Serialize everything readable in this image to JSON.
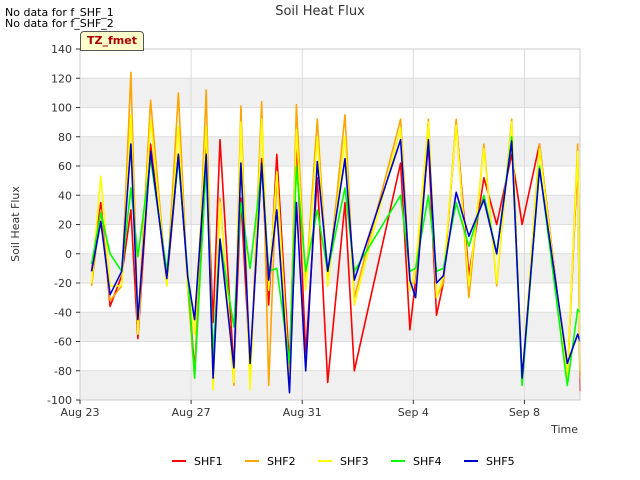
{
  "notices": [
    "No data for f_SHF_1",
    "No data for f_SHF_2"
  ],
  "badge": "TZ_fmet",
  "chart_data": {
    "type": "line",
    "title": "Soil Heat Flux",
    "xlabel": "Time",
    "ylabel": "Soil Heat Flux",
    "xlim": [
      "2023-08-23",
      "2023-09-10"
    ],
    "ylim": [
      -100,
      140
    ],
    "yticks": [
      -100,
      -80,
      -60,
      -40,
      -20,
      0,
      20,
      40,
      60,
      80,
      100,
      120,
      140
    ],
    "xticks": [
      {
        "value": "2023-08-23",
        "label": "Aug 23"
      },
      {
        "value": "2023-08-27",
        "label": "Aug 27"
      },
      {
        "value": "2023-08-31",
        "label": "Aug 31"
      },
      {
        "value": "2023-09-04",
        "label": "Sep 4"
      },
      {
        "value": "2023-09-08",
        "label": "Sep 8"
      }
    ],
    "grid": true,
    "legend_position": "bottom",
    "series": [
      {
        "name": "SHF1",
        "color": "#ff0000",
        "x": [
          "2023-08-23T10:00",
          "2023-08-23T18:00",
          "2023-08-24T02:00",
          "2023-08-24T12:00",
          "2023-08-24T20:00",
          "2023-08-25T02:00",
          "2023-08-25T13:00",
          "2023-08-26T03:00",
          "2023-08-26T13:00",
          "2023-08-26T21:00",
          "2023-08-27T03:00",
          "2023-08-27T13:00",
          "2023-08-27T19:00",
          "2023-08-28T01:00",
          "2023-08-28T13:00",
          "2023-08-28T19:00",
          "2023-08-29T03:00",
          "2023-08-29T13:00",
          "2023-08-29T19:00",
          "2023-08-30T02:00",
          "2023-08-30T13:00",
          "2023-08-30T19:00",
          "2023-08-31T03:00",
          "2023-08-31T13:00",
          "2023-08-31T22:00",
          "2023-09-01T13:00",
          "2023-09-01T21:00",
          "2023-09-03T13:00",
          "2023-09-03T21:00",
          "2023-09-04T02:00",
          "2023-09-04T13:00",
          "2023-09-04T20:00",
          "2023-09-05T02:00",
          "2023-09-05T13:00",
          "2023-09-06T00:00",
          "2023-09-06T13:00",
          "2023-09-07T00:00",
          "2023-09-07T13:00",
          "2023-09-07T22:00",
          "2023-09-08T13:00",
          "2023-09-09T13:00",
          "2023-09-09T22:00",
          "2023-09-10T00:00"
        ],
        "y": [
          -12,
          35,
          -36,
          -15,
          30,
          -58,
          75,
          -20,
          68,
          -15,
          -80,
          73,
          -47,
          78,
          -80,
          38,
          -78,
          65,
          -35,
          68,
          -78,
          78,
          -68,
          52,
          -88,
          35,
          -80,
          62,
          -52,
          -18,
          75,
          -42,
          -20,
          90,
          -15,
          52,
          20,
          68,
          20,
          75,
          -85,
          65,
          -94
        ]
      },
      {
        "name": "SHF2",
        "color": "#ffa500",
        "x": [
          "2023-08-23T10:00",
          "2023-08-23T18:00",
          "2023-08-24T02:00",
          "2023-08-24T12:00",
          "2023-08-24T20:00",
          "2023-08-25T02:00",
          "2023-08-25T13:00",
          "2023-08-26T03:00",
          "2023-08-26T13:00",
          "2023-08-26T21:00",
          "2023-08-27T03:00",
          "2023-08-27T13:00",
          "2023-08-27T19:00",
          "2023-08-28T01:00",
          "2023-08-28T13:00",
          "2023-08-28T19:00",
          "2023-08-29T03:00",
          "2023-08-29T13:00",
          "2023-08-29T19:00",
          "2023-08-30T02:00",
          "2023-08-30T13:00",
          "2023-08-30T19:00",
          "2023-08-31T03:00",
          "2023-08-31T13:00",
          "2023-08-31T22:00",
          "2023-09-01T13:00",
          "2023-09-01T21:00",
          "2023-09-03T13:00",
          "2023-09-03T21:00",
          "2023-09-04T02:00",
          "2023-09-04T13:00",
          "2023-09-04T20:00",
          "2023-09-05T02:00",
          "2023-09-05T13:00",
          "2023-09-06T00:00",
          "2023-09-06T13:00",
          "2023-09-07T00:00",
          "2023-09-07T13:00",
          "2023-09-07T22:00",
          "2023-09-08T13:00",
          "2023-09-09T13:00",
          "2023-09-09T22:00",
          "2023-09-10T00:00"
        ],
        "y": [
          -22,
          30,
          -32,
          -22,
          124,
          -50,
          105,
          -22,
          110,
          -22,
          -85,
          112,
          -90,
          38,
          -90,
          101,
          -88,
          104,
          -90,
          55,
          -88,
          102,
          -22,
          92,
          -22,
          95,
          -30,
          92,
          -20,
          -20,
          92,
          -30,
          -20,
          92,
          -30,
          75,
          -22,
          92,
          -88,
          75,
          -88,
          75,
          -85
        ]
      },
      {
        "name": "SHF3",
        "color": "#ffff00",
        "x": [
          "2023-08-23T10:00",
          "2023-08-23T18:00",
          "2023-08-24T02:00",
          "2023-08-24T12:00",
          "2023-08-24T20:00",
          "2023-08-25T02:00",
          "2023-08-25T13:00",
          "2023-08-26T03:00",
          "2023-08-26T13:00",
          "2023-08-26T21:00",
          "2023-08-27T03:00",
          "2023-08-27T13:00",
          "2023-08-27T19:00",
          "2023-08-28T01:00",
          "2023-08-28T13:00",
          "2023-08-28T19:00",
          "2023-08-29T03:00",
          "2023-08-29T13:00",
          "2023-08-29T19:00",
          "2023-08-30T02:00",
          "2023-08-30T13:00",
          "2023-08-30T19:00",
          "2023-08-31T03:00",
          "2023-08-31T13:00",
          "2023-08-31T22:00",
          "2023-09-01T13:00",
          "2023-09-01T21:00",
          "2023-09-03T13:00",
          "2023-09-03T21:00",
          "2023-09-04T02:00",
          "2023-09-04T13:00",
          "2023-09-04T20:00",
          "2023-09-05T02:00",
          "2023-09-05T13:00",
          "2023-09-06T00:00",
          "2023-09-06T13:00",
          "2023-09-07T00:00",
          "2023-09-07T13:00",
          "2023-09-07T22:00",
          "2023-09-08T13:00",
          "2023-09-09T13:00",
          "2023-09-09T22:00",
          "2023-09-10T00:00"
        ],
        "y": [
          -20,
          53,
          -22,
          -22,
          95,
          -55,
          92,
          -22,
          87,
          -22,
          -55,
          87,
          -93,
          35,
          -88,
          90,
          -93,
          92,
          -25,
          56,
          -93,
          85,
          -25,
          80,
          -22,
          80,
          -35,
          86,
          -25,
          -10,
          90,
          -30,
          -15,
          88,
          -22,
          72,
          -20,
          90,
          -85,
          72,
          -85,
          70,
          -80
        ]
      },
      {
        "name": "SHF4",
        "color": "#00ff00",
        "x": [
          "2023-08-23T10:00",
          "2023-08-23T18:00",
          "2023-08-24T02:00",
          "2023-08-24T12:00",
          "2023-08-24T20:00",
          "2023-08-25T02:00",
          "2023-08-25T13:00",
          "2023-08-26T03:00",
          "2023-08-26T13:00",
          "2023-08-26T21:00",
          "2023-08-27T03:00",
          "2023-08-27T13:00",
          "2023-08-27T19:00",
          "2023-08-28T01:00",
          "2023-08-28T13:00",
          "2023-08-28T19:00",
          "2023-08-29T03:00",
          "2023-08-29T13:00",
          "2023-08-29T19:00",
          "2023-08-30T02:00",
          "2023-08-30T13:00",
          "2023-08-30T19:00",
          "2023-08-31T03:00",
          "2023-08-31T13:00",
          "2023-08-31T22:00",
          "2023-09-01T13:00",
          "2023-09-01T21:00",
          "2023-09-03T13:00",
          "2023-09-03T21:00",
          "2023-09-04T02:00",
          "2023-09-04T13:00",
          "2023-09-04T20:00",
          "2023-09-05T02:00",
          "2023-09-05T13:00",
          "2023-09-06T00:00",
          "2023-09-06T13:00",
          "2023-09-07T00:00",
          "2023-09-07T13:00",
          "2023-09-07T22:00",
          "2023-09-08T13:00",
          "2023-09-09T13:00",
          "2023-09-09T22:00",
          "2023-09-10T00:00"
        ],
        "y": [
          -7,
          28,
          0,
          -12,
          45,
          -2,
          65,
          -12,
          65,
          -12,
          -85,
          60,
          -70,
          10,
          -50,
          35,
          -10,
          58,
          -12,
          -10,
          -75,
          60,
          -12,
          30,
          -12,
          45,
          -12,
          40,
          -12,
          -10,
          40,
          -12,
          -10,
          35,
          5,
          40,
          0,
          80,
          -90,
          60,
          -90,
          -38,
          -40
        ]
      },
      {
        "name": "SHF5",
        "color": "#0000cc",
        "x": [
          "2023-08-23T10:00",
          "2023-08-23T18:00",
          "2023-08-24T02:00",
          "2023-08-24T12:00",
          "2023-08-24T20:00",
          "2023-08-25T02:00",
          "2023-08-25T13:00",
          "2023-08-26T03:00",
          "2023-08-26T13:00",
          "2023-08-26T21:00",
          "2023-08-27T03:00",
          "2023-08-27T13:00",
          "2023-08-27T19:00",
          "2023-08-28T01:00",
          "2023-08-28T13:00",
          "2023-08-28T19:00",
          "2023-08-29T03:00",
          "2023-08-29T13:00",
          "2023-08-29T19:00",
          "2023-08-30T02:00",
          "2023-08-30T13:00",
          "2023-08-30T19:00",
          "2023-08-31T03:00",
          "2023-08-31T13:00",
          "2023-08-31T22:00",
          "2023-09-01T13:00",
          "2023-09-01T21:00",
          "2023-09-03T13:00",
          "2023-09-03T21:00",
          "2023-09-04T02:00",
          "2023-09-04T13:00",
          "2023-09-04T20:00",
          "2023-09-05T02:00",
          "2023-09-05T13:00",
          "2023-09-06T00:00",
          "2023-09-06T13:00",
          "2023-09-07T00:00",
          "2023-09-07T13:00",
          "2023-09-07T22:00",
          "2023-09-08T13:00",
          "2023-09-09T13:00",
          "2023-09-09T22:00",
          "2023-09-10T00:00"
        ],
        "y": [
          -12,
          22,
          -28,
          -12,
          75,
          -45,
          70,
          -17,
          68,
          -15,
          -45,
          68,
          -85,
          10,
          -78,
          62,
          -75,
          62,
          -18,
          30,
          -95,
          35,
          -80,
          63,
          -12,
          65,
          -18,
          78,
          -18,
          -30,
          78,
          -20,
          -15,
          42,
          12,
          37,
          0,
          77,
          -85,
          58,
          -75,
          -55,
          -60
        ]
      }
    ]
  }
}
